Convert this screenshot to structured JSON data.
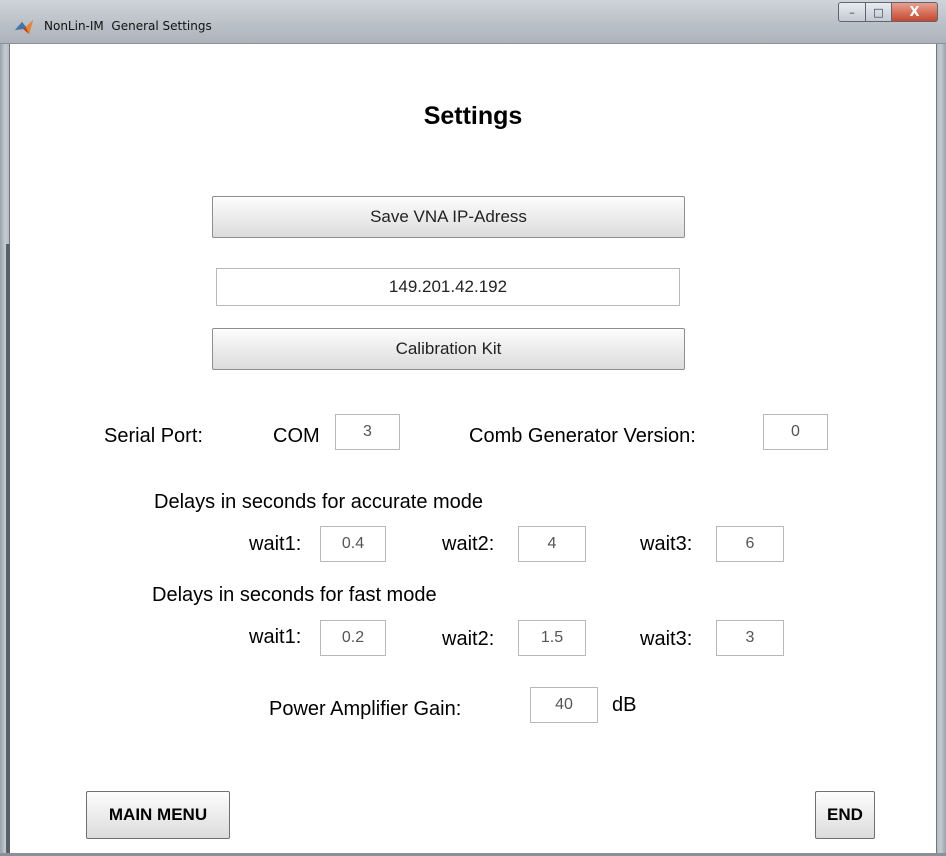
{
  "window": {
    "title": "NonLin-IM  General Settings",
    "app_icon": "matlab-icon",
    "controls": {
      "minimize": "–",
      "maximize": "□",
      "close": "X"
    }
  },
  "heading": "Settings",
  "vna": {
    "save_button": "Save VNA IP-Adress",
    "ip_value": "149.201.42.192",
    "calibration_button": "Calibration Kit"
  },
  "serial": {
    "label": "Serial Port:",
    "com_label": "COM",
    "com_value": "3",
    "comb_label": "Comb Generator Version:",
    "comb_value": "0"
  },
  "accurate": {
    "heading": "Delays in seconds for accurate mode",
    "wait1_label": "wait1:",
    "wait1_value": "0.4",
    "wait2_label": "wait2:",
    "wait2_value": "4",
    "wait3_label": "wait3:",
    "wait3_value": "6"
  },
  "fast": {
    "heading": "Delays in seconds for fast mode",
    "wait1_label": "wait1:",
    "wait1_value": "0.2",
    "wait2_label": "wait2:",
    "wait2_value": "1.5",
    "wait3_label": "wait3:",
    "wait3_value": "3"
  },
  "amplifier": {
    "label": "Power Amplifier Gain:",
    "value": "40",
    "unit": "dB"
  },
  "footer": {
    "main_menu": "MAIN MENU",
    "end": "END"
  }
}
